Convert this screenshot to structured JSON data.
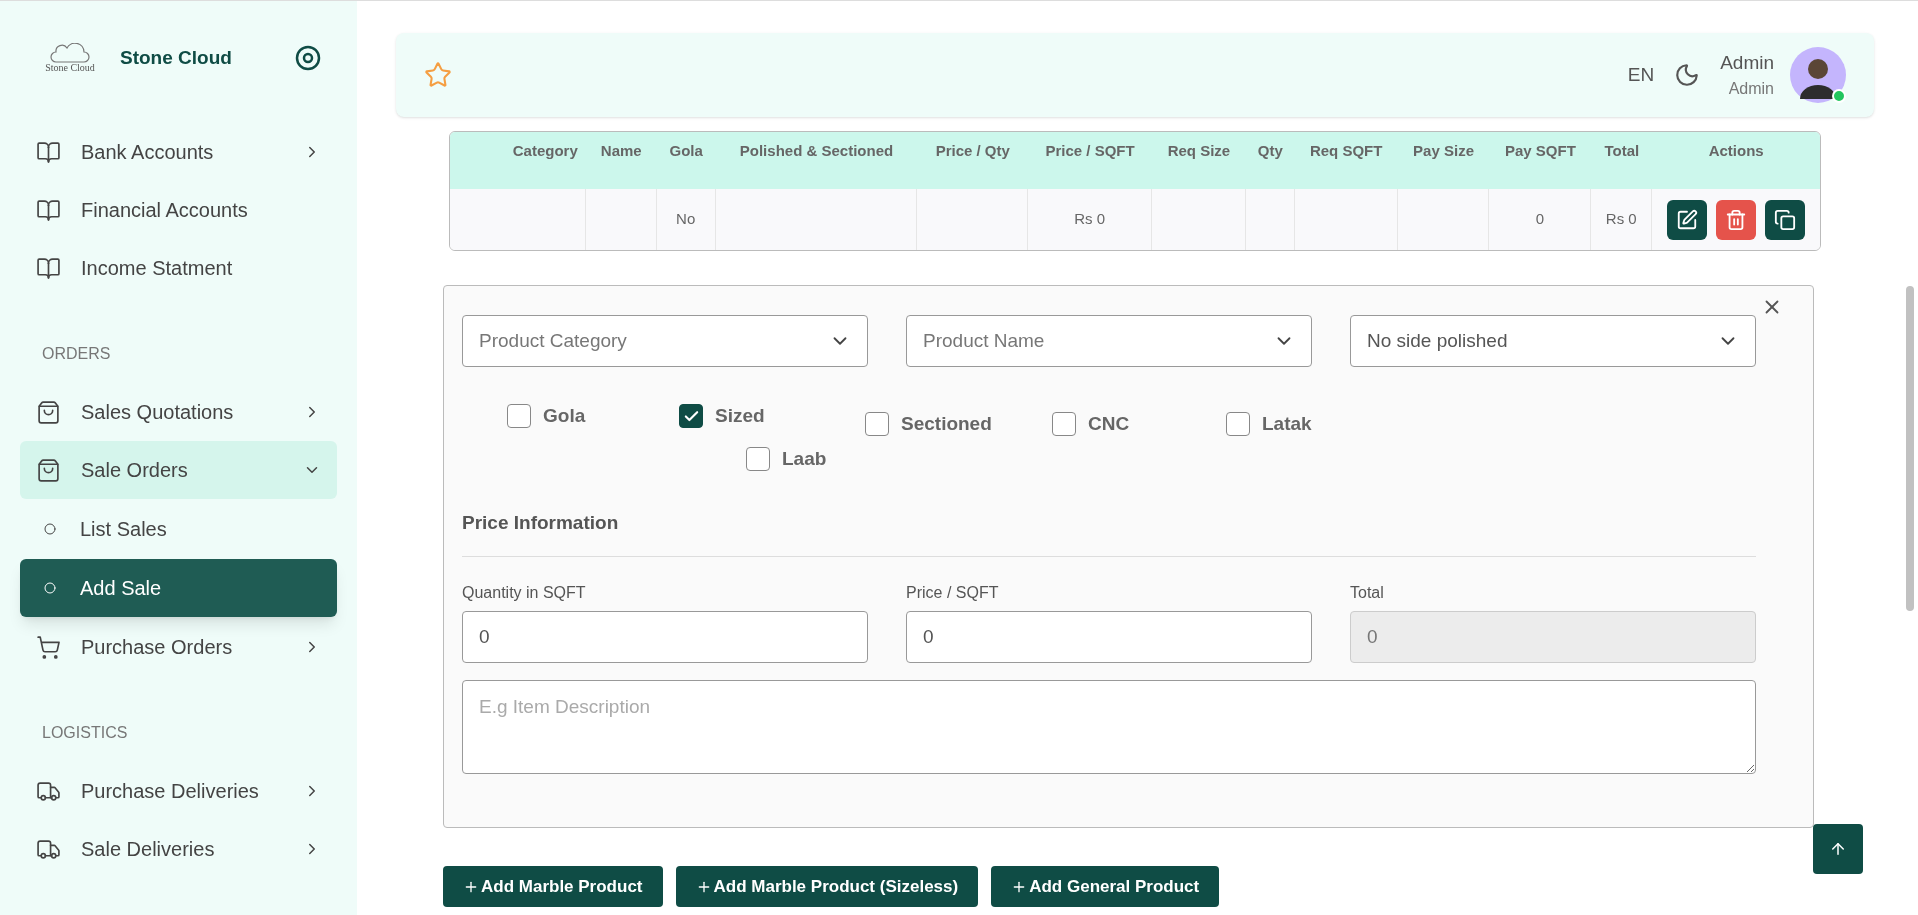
{
  "sidebar": {
    "logo_text": "Stone Cloud",
    "title": "Stone Cloud",
    "sections": [
      {
        "items": [
          {
            "label": "Bank Accounts",
            "kind": "book",
            "expanded": false,
            "selected": false
          },
          {
            "label": "Financial Accounts",
            "kind": "book",
            "selected": false
          },
          {
            "label": "Income Statment",
            "kind": "book",
            "selected": false
          }
        ]
      },
      {
        "heading": "ORDERS",
        "items": [
          {
            "label": "Sales Quotations",
            "kind": "bag",
            "expanded": false,
            "selected": false
          },
          {
            "label": "Sale Orders",
            "kind": "bag",
            "expanded": true,
            "selected": false,
            "children": [
              {
                "label": "List Sales",
                "selected": false
              },
              {
                "label": "Add Sale",
                "selected": true
              }
            ]
          },
          {
            "label": "Purchase Orders",
            "kind": "cart",
            "expanded": false,
            "selected": false
          }
        ]
      },
      {
        "heading": "LOGISTICS",
        "items": [
          {
            "label": "Purchase Deliveries",
            "kind": "truck",
            "expanded": false,
            "selected": false
          },
          {
            "label": "Sale Deliveries",
            "kind": "truck",
            "expanded": false,
            "selected": false
          }
        ]
      }
    ]
  },
  "header": {
    "language": "EN",
    "user_name": "Admin",
    "user_role": "Admin",
    "online": true
  },
  "table": {
    "columns": [
      "Category",
      "Name",
      "Gola",
      "Polished & Sectioned",
      "Price / Qty",
      "Price / SQFT",
      "Req Size",
      "Qty",
      "Req SQFT",
      "Pay Size",
      "Pay SQFT",
      "Total",
      "Actions"
    ],
    "rows": [
      {
        "cells": [
          null,
          null,
          "No",
          null,
          null,
          "Rs 0",
          null,
          null,
          null,
          null,
          "0",
          "Rs 0"
        ],
        "actions": [
          {
            "kind": "edit"
          },
          {
            "kind": "delete"
          },
          {
            "kind": "copy"
          }
        ]
      }
    ]
  },
  "form": {
    "selects": [
      {
        "placeholder": "Product Category"
      },
      {
        "placeholder": "Product Name"
      },
      {
        "value": "No side polished"
      }
    ],
    "options": [
      {
        "label": "Gola",
        "checked": false
      },
      {
        "label": "Sized",
        "checked": true
      },
      {
        "label": "Sectioned",
        "checked": false
      },
      {
        "label": "CNC",
        "checked": false
      },
      {
        "label": "Latak",
        "checked": false
      },
      {
        "label": "Laab",
        "checked": false
      }
    ],
    "section_title": "Price Information",
    "fields": [
      {
        "label": "Quantity in SQFT",
        "value": "0",
        "disabled": false
      },
      {
        "label": "Price / SQFT",
        "value": "0",
        "disabled": false
      },
      {
        "label": "Total",
        "value": "0",
        "disabled": true
      }
    ],
    "description": {
      "placeholder": "E.g Item Description"
    }
  },
  "buttons": [
    "Add Marble Product",
    "Add Marble Product (Sizeless)",
    "Add General Product"
  ]
}
